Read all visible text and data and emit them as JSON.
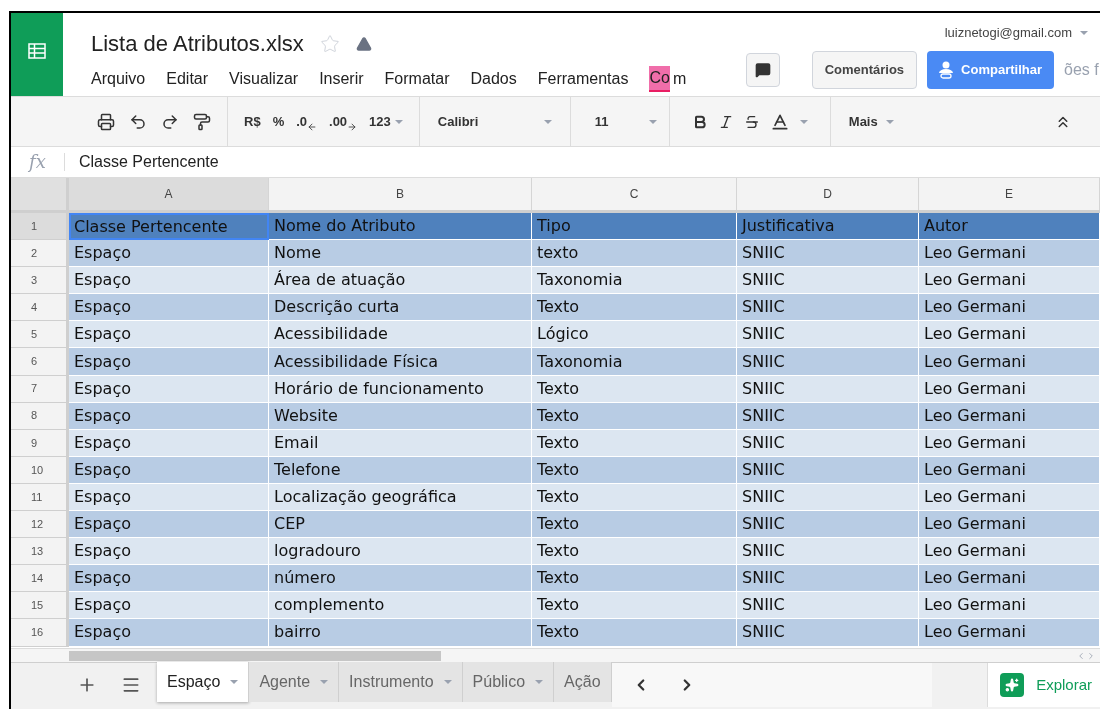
{
  "document": {
    "title": "Lista de Atributos.xlsx",
    "starred": false
  },
  "account": {
    "email": "luiznetogi@gmail.com"
  },
  "menu": [
    "Arquivo",
    "Editar",
    "Visualizar",
    "Inserir",
    "Formatar",
    "Dados",
    "Ferramentas",
    "Co",
    "m"
  ],
  "save_status": "ões f",
  "buttons": {
    "comments": "Comentários",
    "share": "Compartilhar"
  },
  "toolbar": {
    "currency": "R$",
    "percent": "%",
    "decrease_decimals": ".0",
    "increase_decimals": ".00",
    "number_format": "123",
    "font": "Calibri",
    "font_size": "11",
    "more": "Mais"
  },
  "formula_bar": {
    "label": "fx",
    "value": "Classe Pertencente"
  },
  "columns": [
    {
      "label": "A",
      "selected": true
    },
    {
      "label": "B",
      "selected": false
    },
    {
      "label": "C",
      "selected": false
    },
    {
      "label": "D",
      "selected": false
    },
    {
      "label": "E",
      "selected": false
    }
  ],
  "rows": [
    {
      "number": "1",
      "kind": "header",
      "selected": true,
      "cells": [
        "Classe Pertencente",
        "Nome do Atributo",
        "Tipo",
        "Justificativa",
        "Autor"
      ]
    },
    {
      "number": "2",
      "kind": "data",
      "selected": false,
      "cells": [
        "Espaço",
        "Nome",
        "texto",
        "SNIIC",
        "Leo Germani"
      ]
    },
    {
      "number": "3",
      "kind": "data",
      "selected": false,
      "cells": [
        "Espaço",
        "Área de atuação",
        "Taxonomia",
        "SNIIC",
        "Leo Germani"
      ]
    },
    {
      "number": "4",
      "kind": "data",
      "selected": false,
      "cells": [
        "Espaço",
        "Descrição curta",
        "Texto",
        "SNIIC",
        "Leo Germani"
      ]
    },
    {
      "number": "5",
      "kind": "data",
      "selected": false,
      "cells": [
        "Espaço",
        "Acessibilidade",
        "Lógico",
        "SNIIC",
        "Leo Germani"
      ]
    },
    {
      "number": "6",
      "kind": "data",
      "selected": false,
      "cells": [
        "Espaço",
        "Acessibilidade Física",
        "Taxonomia",
        "SNIIC",
        "Leo Germani"
      ]
    },
    {
      "number": "7",
      "kind": "data",
      "selected": false,
      "cells": [
        "Espaço",
        "Horário de funcionamento",
        "Texto",
        "SNIIC",
        "Leo Germani"
      ]
    },
    {
      "number": "8",
      "kind": "data",
      "selected": false,
      "cells": [
        "Espaço",
        "Website",
        "Texto",
        "SNIIC",
        "Leo Germani"
      ]
    },
    {
      "number": "9",
      "kind": "data",
      "selected": false,
      "cells": [
        "Espaço",
        "Email",
        "Texto",
        "SNIIC",
        "Leo Germani"
      ]
    },
    {
      "number": "10",
      "kind": "data",
      "selected": false,
      "cells": [
        "Espaço",
        "Telefone",
        "Texto",
        "SNIIC",
        "Leo Germani"
      ]
    },
    {
      "number": "11",
      "kind": "data",
      "selected": false,
      "cells": [
        "Espaço",
        "Localização geográfica",
        "Texto",
        "SNIIC",
        "Leo Germani"
      ]
    },
    {
      "number": "12",
      "kind": "data",
      "selected": false,
      "cells": [
        "Espaço",
        "CEP",
        "Texto",
        "SNIIC",
        "Leo Germani"
      ]
    },
    {
      "number": "13",
      "kind": "data",
      "selected": false,
      "cells": [
        "Espaço",
        "logradouro",
        "Texto",
        "SNIIC",
        "Leo Germani"
      ]
    },
    {
      "number": "14",
      "kind": "data",
      "selected": false,
      "cells": [
        "Espaço",
        "número",
        "Texto",
        "SNIIC",
        "Leo Germani"
      ]
    },
    {
      "number": "15",
      "kind": "data",
      "selected": false,
      "cells": [
        "Espaço",
        "complemento",
        "Texto",
        "SNIIC",
        "Leo Germani"
      ]
    },
    {
      "number": "16",
      "kind": "data",
      "selected": false,
      "cells": [
        "Espaço",
        "bairro",
        "Texto",
        "SNIIC",
        "Leo Germani"
      ]
    }
  ],
  "sheets": [
    {
      "label": "Espaço",
      "selected": true,
      "dropdown": true
    },
    {
      "label": "Agente",
      "selected": false,
      "dropdown": true
    },
    {
      "label": "Instrumento",
      "selected": false,
      "dropdown": true
    },
    {
      "label": "Público",
      "selected": false,
      "dropdown": true
    },
    {
      "label": "Ação",
      "selected": false,
      "dropdown": false
    }
  ],
  "explore": "Explorar"
}
